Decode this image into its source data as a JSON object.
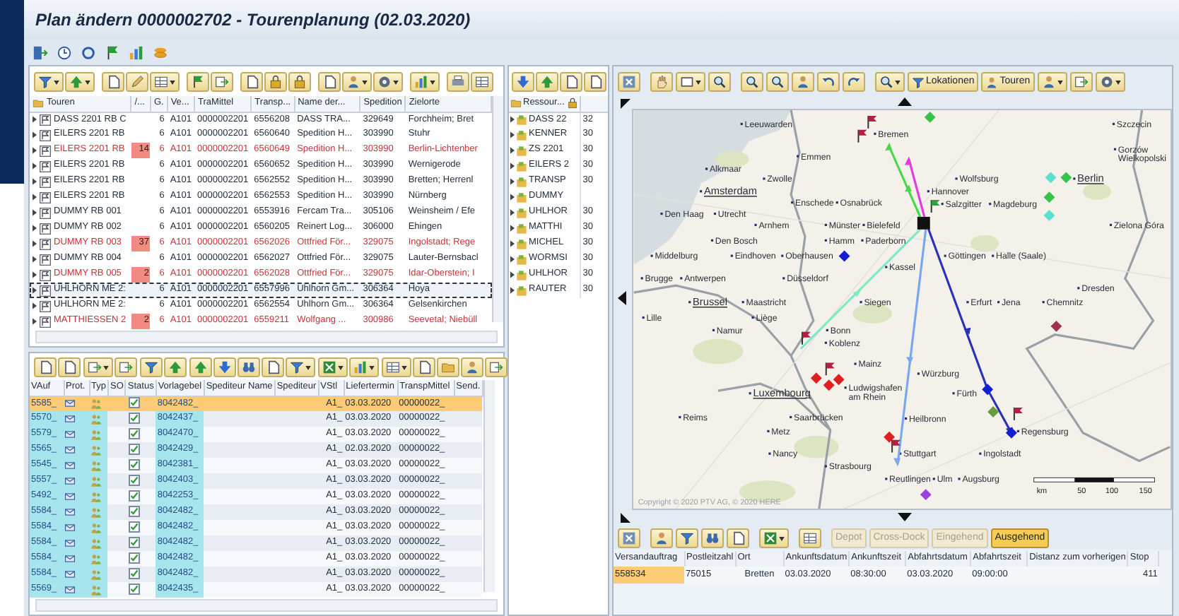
{
  "window": {
    "title": "Plan ändern 0000002702 - Tourenplanung (02.03.2020)"
  },
  "tours": {
    "columns": [
      "Touren",
      "/...",
      "G.",
      "Ve...",
      "TraMittel",
      "Transp...",
      "Name der...",
      "Spedition",
      "Zielorte"
    ],
    "rows": [
      {
        "name": "DASS 2201 RB C",
        "g": "6",
        "ve": "A101",
        "tramittel": "0000002201",
        "transp": "6556208",
        "carrier": "DASS TRA...",
        "spedition": "329649",
        "destinations": "Forchheim; Bret",
        "flagged": false,
        "selected": false
      },
      {
        "name": "EILERS 2201 RB",
        "g": "6",
        "ve": "A101",
        "tramittel": "0000002201",
        "transp": "6560640",
        "carrier": "Spedition H...",
        "spedition": "303990",
        "destinations": "Stuhr",
        "flagged": false,
        "selected": false
      },
      {
        "name": "EILERS 2201 RB",
        "count": "14",
        "g": "6",
        "ve": "A101",
        "tramittel": "0000002201",
        "transp": "6560649",
        "carrier": "Spedition H...",
        "spedition": "303990",
        "destinations": "Berlin-Lichtenber",
        "flagged": true,
        "selected": false
      },
      {
        "name": "EILERS 2201 RB",
        "g": "6",
        "ve": "A101",
        "tramittel": "0000002201",
        "transp": "6560652",
        "carrier": "Spedition H...",
        "spedition": "303990",
        "destinations": "Wernigerode",
        "flagged": false,
        "selected": false
      },
      {
        "name": "EILERS 2201 RB",
        "g": "6",
        "ve": "A101",
        "tramittel": "0000002201",
        "transp": "6562552",
        "carrier": "Spedition H...",
        "spedition": "303990",
        "destinations": "Bretten; Herrenl",
        "flagged": false,
        "selected": false
      },
      {
        "name": "EILERS 2201 RB",
        "g": "6",
        "ve": "A101",
        "tramittel": "0000002201",
        "transp": "6562553",
        "carrier": "Spedition H...",
        "spedition": "303990",
        "destinations": "Nürnberg",
        "flagged": false,
        "selected": false
      },
      {
        "name": "DUMMY RB 001",
        "g": "6",
        "ve": "A101",
        "tramittel": "0000002201",
        "transp": "6553916",
        "carrier": "Fercam Tra...",
        "spedition": "305106",
        "destinations": "Weinsheim / Efe",
        "flagged": false,
        "selected": false
      },
      {
        "name": "DUMMY RB 002",
        "g": "6",
        "ve": "A101",
        "tramittel": "0000002201",
        "transp": "6560205",
        "carrier": "Reinert Log...",
        "spedition": "306000",
        "destinations": "Ehingen",
        "flagged": false,
        "selected": false
      },
      {
        "name": "DUMMY RB 003",
        "count": "37",
        "g": "6",
        "ve": "A101",
        "tramittel": "0000002201",
        "transp": "6562026",
        "carrier": "Ottfried För...",
        "spedition": "329075",
        "destinations": "Ingolstadt; Rege",
        "flagged": true,
        "selected": false
      },
      {
        "name": "DUMMY RB 004",
        "g": "6",
        "ve": "A101",
        "tramittel": "0000002201",
        "transp": "6562027",
        "carrier": "Ottfried För...",
        "spedition": "329075",
        "destinations": "Lauter-Bernsbacl",
        "flagged": false,
        "selected": false
      },
      {
        "name": "DUMMY RB 005",
        "count": "2",
        "g": "6",
        "ve": "A101",
        "tramittel": "0000002201",
        "transp": "6562028",
        "carrier": "Ottfried För...",
        "spedition": "329075",
        "destinations": "Idar-Oberstein; I",
        "flagged": true,
        "selected": false
      },
      {
        "name": "UHLHORN ME 2:",
        "g": "6",
        "ve": "A101",
        "tramittel": "0000002201",
        "transp": "6557996",
        "carrier": "Uhlhorn Gm...",
        "spedition": "306364",
        "destinations": "Hoya",
        "flagged": false,
        "selected": true
      },
      {
        "name": "UHLHORN ME 2:",
        "g": "6",
        "ve": "A101",
        "tramittel": "0000002201",
        "transp": "6562554",
        "carrier": "Uhlhorn Gm...",
        "spedition": "306364",
        "destinations": "Gelsenkirchen",
        "flagged": false,
        "selected": false
      },
      {
        "name": "MATTHIESSEN 2",
        "count": "2",
        "g": "6",
        "ve": "A101",
        "tramittel": "0000002201",
        "transp": "6559211",
        "carrier": "Wolfgang ...",
        "spedition": "300986",
        "destinations": "Seevetal; Niebüll",
        "flagged": true,
        "selected": false
      }
    ]
  },
  "resources": {
    "column": "Ressour...",
    "rows": [
      {
        "name": "DASS 22",
        "value": "32"
      },
      {
        "name": "KENNER",
        "value": "30"
      },
      {
        "name": "ZS 2201",
        "value": "30"
      },
      {
        "name": "EILERS 2",
        "value": "30"
      },
      {
        "name": "TRANSP",
        "value": "30"
      },
      {
        "name": "DUMMY"
      },
      {
        "name": "UHLHOR",
        "value": "30"
      },
      {
        "name": "MATTHI",
        "value": "30"
      },
      {
        "name": "MICHEL",
        "value": "30"
      },
      {
        "name": "WORMSI",
        "value": "30"
      },
      {
        "name": "UHLHOR",
        "value": "30"
      },
      {
        "name": "RAUTER",
        "value": "30"
      }
    ]
  },
  "orders": {
    "columns": [
      "VAuf",
      "Prot.",
      "Typ",
      "SO",
      "Status",
      "Vorlagebel",
      "Spediteur Name",
      "Spediteur",
      "VStl",
      "Liefertermin",
      "TranspMittel",
      "Send."
    ],
    "rows": [
      {
        "vauf": "5585_",
        "document": "8042482_",
        "vstl": "A1_",
        "date": "03.03.2020",
        "transport": "00000022_",
        "checked": true,
        "selected": true
      },
      {
        "vauf": "5570_",
        "document": "8042437_",
        "vstl": "A1_",
        "date": "03.03.2020",
        "transport": "00000022_",
        "checked": true,
        "selected": false
      },
      {
        "vauf": "5579_",
        "document": "8042470_",
        "vstl": "A1_",
        "date": "03.03.2020",
        "transport": "00000022_",
        "checked": true,
        "selected": false
      },
      {
        "vauf": "5565_",
        "document": "8042429_",
        "vstl": "A1_",
        "date": "02.03.2020",
        "transport": "00000022_",
        "checked": true,
        "selected": false
      },
      {
        "vauf": "5545_",
        "document": "8042381_",
        "vstl": "A1_",
        "date": "03.03.2020",
        "transport": "00000022_",
        "checked": true,
        "selected": false
      },
      {
        "vauf": "5557_",
        "document": "8042403_",
        "vstl": "A1_",
        "date": "03.03.2020",
        "transport": "00000022_",
        "checked": true,
        "selected": false
      },
      {
        "vauf": "5492_",
        "document": "8042253_",
        "vstl": "A1_",
        "date": "03.03.2020",
        "transport": "00000022_",
        "checked": true,
        "selected": false
      },
      {
        "vauf": "5584_",
        "document": "8042482_",
        "vstl": "A1_",
        "date": "03.03.2020",
        "transport": "00000022_",
        "checked": true,
        "selected": false
      },
      {
        "vauf": "5584_",
        "document": "8042482_",
        "vstl": "A1_",
        "date": "03.03.2020",
        "transport": "00000022_",
        "checked": true,
        "selected": false
      },
      {
        "vauf": "5584_",
        "document": "8042482_",
        "vstl": "A1_",
        "date": "03.03.2020",
        "transport": "00000022_",
        "checked": true,
        "selected": false
      },
      {
        "vauf": "5584_",
        "document": "8042482_",
        "vstl": "A1_",
        "date": "03.03.2020",
        "transport": "00000022_",
        "checked": true,
        "selected": false
      },
      {
        "vauf": "5584_",
        "document": "8042482_",
        "vstl": "A1_",
        "date": "03.03.2020",
        "transport": "00000022_",
        "checked": true,
        "selected": false
      },
      {
        "vauf": "5569_",
        "document": "8042435_",
        "vstl": "A1_",
        "date": "03.03.2020",
        "transport": "00000022_",
        "checked": true,
        "selected": false
      }
    ]
  },
  "map": {
    "buttons": [
      "Lokationen",
      "Touren"
    ],
    "places": [
      {
        "name": "Leeuwarden",
        "kind": "city"
      },
      {
        "name": "Szczecin",
        "kind": "city"
      },
      {
        "name": "Bremen",
        "kind": "city"
      },
      {
        "name": "Emmen",
        "kind": "city"
      },
      {
        "name": "Gorzów Wielkopolski",
        "kind": "two_line"
      },
      {
        "name": "Alkmaar",
        "kind": "city"
      },
      {
        "name": "Zwolle",
        "kind": "city"
      },
      {
        "name": "Wolfsburg",
        "kind": "city"
      },
      {
        "name": "Berlin",
        "kind": "capital"
      },
      {
        "name": "Amsterdam",
        "kind": "capital"
      },
      {
        "name": "Hannover",
        "kind": "city"
      },
      {
        "name": "Enschede",
        "kind": "city"
      },
      {
        "name": "Osnabrück",
        "kind": "city"
      },
      {
        "name": "Salzgitter",
        "kind": "city"
      },
      {
        "name": "Magdeburg",
        "kind": "city"
      },
      {
        "name": "Den Haag",
        "kind": "city"
      },
      {
        "name": "Utrecht",
        "kind": "city"
      },
      {
        "name": "Arnhem",
        "kind": "city"
      },
      {
        "name": "Münster",
        "kind": "city"
      },
      {
        "name": "Bielefeld",
        "kind": "city"
      },
      {
        "name": "Zielona Góra",
        "kind": "city"
      },
      {
        "name": "Den Bosch",
        "kind": "city"
      },
      {
        "name": "Hamm",
        "kind": "city"
      },
      {
        "name": "Paderborn",
        "kind": "city"
      },
      {
        "name": "Middelburg",
        "kind": "city"
      },
      {
        "name": "Eindhoven",
        "kind": "city"
      },
      {
        "name": "Oberhausen",
        "kind": "city"
      },
      {
        "name": "Göttingen",
        "kind": "city"
      },
      {
        "name": "Halle (Saale)",
        "kind": "city"
      },
      {
        "name": "Kassel",
        "kind": "city"
      },
      {
        "name": "Brugge",
        "kind": "city"
      },
      {
        "name": "Antwerpen",
        "kind": "city"
      },
      {
        "name": "Düsseldorf",
        "kind": "city"
      },
      {
        "name": "Dresden",
        "kind": "city"
      },
      {
        "name": "Brussel",
        "kind": "capital"
      },
      {
        "name": "Maastricht",
        "kind": "city"
      },
      {
        "name": "Siegen",
        "kind": "city"
      },
      {
        "name": "Erfurt",
        "kind": "city"
      },
      {
        "name": "Jena",
        "kind": "city"
      },
      {
        "name": "Chemnitz",
        "kind": "city"
      },
      {
        "name": "Lille",
        "kind": "city"
      },
      {
        "name": "Liège",
        "kind": "city"
      },
      {
        "name": "Namur",
        "kind": "city"
      },
      {
        "name": "Bonn",
        "kind": "city"
      },
      {
        "name": "Koblenz",
        "kind": "city"
      },
      {
        "name": "Mainz",
        "kind": "city"
      },
      {
        "name": "Würzburg",
        "kind": "city"
      },
      {
        "name": "Luxembourg",
        "kind": "capital"
      },
      {
        "name": "Ludwigshafen am Rhein",
        "kind": "two_line"
      },
      {
        "name": "Fürth",
        "kind": "city"
      },
      {
        "name": "Reims",
        "kind": "city"
      },
      {
        "name": "Saarbrücken",
        "kind": "city"
      },
      {
        "name": "Heilbronn",
        "kind": "city"
      },
      {
        "name": "Metz",
        "kind": "city"
      },
      {
        "name": "Regensburg",
        "kind": "city"
      },
      {
        "name": "Nancy",
        "kind": "city"
      },
      {
        "name": "Stuttgart",
        "kind": "city"
      },
      {
        "name": "Ingolstadt",
        "kind": "city"
      },
      {
        "name": "Strasbourg",
        "kind": "city"
      },
      {
        "name": "Reutlingen",
        "kind": "city"
      },
      {
        "name": "Ulm",
        "kind": "city"
      },
      {
        "name": "Augsburg",
        "kind": "city"
      }
    ],
    "copyright": "Copyright © 2020 PTV AG, © 2020 HERE",
    "scale": {
      "unit": "km",
      "ticks": [
        "50",
        "100",
        "150"
      ]
    }
  },
  "stops": {
    "filters": [
      {
        "label": "Depot",
        "selected": false
      },
      {
        "label": "Cross-Dock",
        "selected": false
      },
      {
        "label": "Eingehend",
        "selected": false
      },
      {
        "label": "Ausgehend",
        "selected": true
      }
    ],
    "columns": [
      "Versandauftrag",
      "Postleitzahl",
      "Ort",
      "Ankunftsdatum",
      "Ankunftszeit",
      "Abfahrtsdatum",
      "Abfahrtszeit",
      "Distanz zum vorherigen",
      "Stop"
    ],
    "rows": [
      {
        "order": "558534",
        "zip": "75015",
        "city": "Bretten",
        "arrival_date": "03.03.2020",
        "arrival_time": "08:30:00",
        "departure_date": "03.03.2020",
        "departure_time": "09:00:00",
        "stop": "411",
        "selected": true
      }
    ]
  }
}
